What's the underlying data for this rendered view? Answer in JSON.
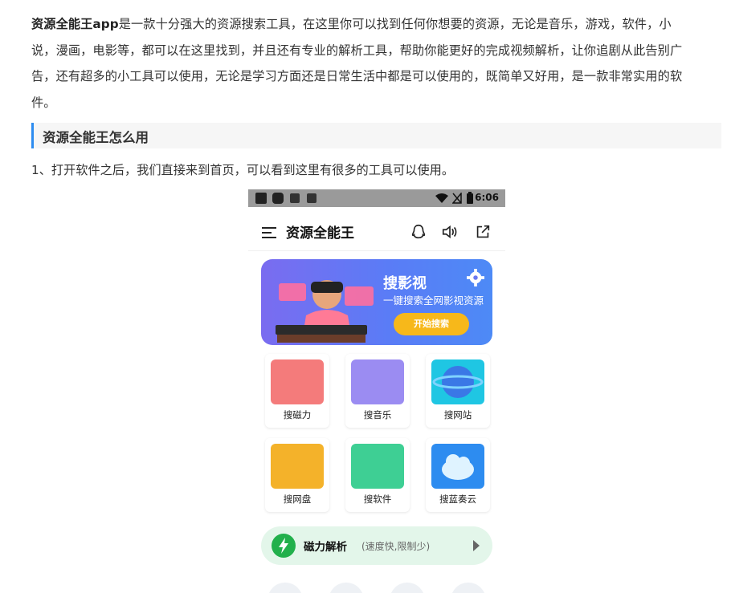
{
  "article": {
    "intro_bold": "资源全能王app",
    "intro_line1": "是一款十分强大的资源搜索工具，在这里你可以找到任何你想要的资源，无论是音乐，游戏，软件，小",
    "intro_line2": "说，漫画，电影等，都可以在这里找到，并且还有专业的解析工具，帮助你能更好的完成视频解析，让你追剧从此告别广",
    "intro_line3": "告，还有超多的小工具可以使用，无论是学习方面还是日常生活中都是可以使用的，既简单又好用，是一款非常实用的软",
    "intro_line4": "件。",
    "section_heading": "资源全能王怎么用",
    "step1": "1、打开软件之后，我们直接来到首页，可以看到这里有很多的工具可以使用。"
  },
  "phone": {
    "status_time": "6:06",
    "app_title": "资源全能王",
    "banner": {
      "title": "搜影视",
      "subtitle": "一键搜索全网影视资源",
      "button": "开始搜索"
    },
    "tools": [
      {
        "label": "搜磁力",
        "color": "#f47b7b"
      },
      {
        "label": "搜音乐",
        "color": "#9b8cf2"
      },
      {
        "label": "搜网站",
        "color": "#1fc6e3"
      },
      {
        "label": "搜网盘",
        "color": "#f4b22a"
      },
      {
        "label": "搜软件",
        "color": "#3ecf94"
      },
      {
        "label": "搜蓝奏云",
        "color": "#2d8cf0"
      }
    ],
    "parse": {
      "title": "磁力解析",
      "subtitle": "(速度快,限制少)"
    }
  },
  "colors": {
    "heading_accent": "#2d8cf0",
    "banner_button": "#f7b81a",
    "parse_bg": "#e3f6ea"
  }
}
